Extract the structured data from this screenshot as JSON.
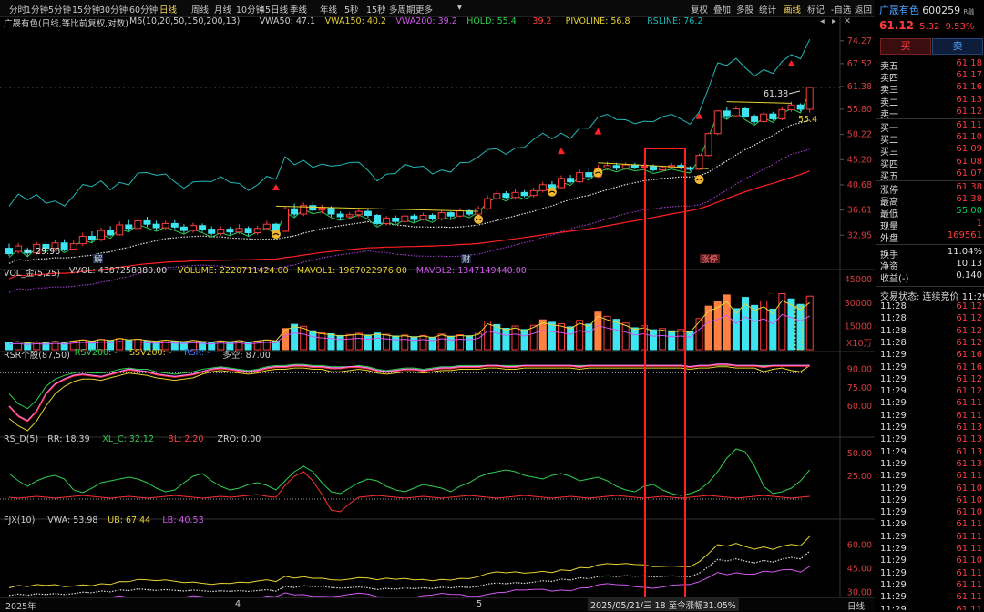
{
  "timeframes": [
    "分时",
    "1分钟",
    "5分钟",
    "15分钟",
    "30分钟",
    "60分钟",
    "日线",
    "周线",
    "月线",
    "10分钟",
    "45日线",
    "季线",
    "年线",
    "5秒",
    "15秒",
    "多周期",
    "更多"
  ],
  "active_timeframe": "日线",
  "toolbar_right": [
    "复权",
    "叠加",
    "多股",
    "统计",
    "画线",
    "标记",
    "-自选",
    "返回"
  ],
  "toolbar_active": "画线",
  "chart_title": "广晟有色(日线,等比前复权,对数)",
  "main_legend": [
    {
      "text": "M6(10,20,50,150,200,13)",
      "color": "#cfcfcf"
    },
    {
      "text": "VWA50: 47.1",
      "color": "#cfcfcf"
    },
    {
      "text": "VWA150: 40.2",
      "color": "#e8d431"
    },
    {
      "text": "VWA200: 39.2",
      "color": "#d257f0"
    },
    {
      "text": "HOLD: 55.4",
      "color": "#2fce4f"
    },
    {
      "text": ": 39.2",
      "color": "#ff4040"
    },
    {
      "text": "PIVOLINE: 56.8",
      "color": "#e8d431"
    },
    {
      "text": "RSLINE: 76.2",
      "color": "#20b8b8"
    }
  ],
  "price_axis": [
    "74.27",
    "67.52",
    "61.38",
    "55.80",
    "50.22",
    "45.20",
    "40.68",
    "36.61",
    "32.95"
  ],
  "min_label": "← 29.96",
  "high_label": "61.38",
  "hold_label": "55.4",
  "markers": {
    "jie": "解",
    "cai": "财",
    "zhangting": "涨停"
  },
  "vol_legend": [
    {
      "text": "VOL_金(5,25)",
      "color": "#cfcfcf"
    },
    {
      "text": "VVOL: 4387258880.00",
      "color": "#cfcfcf"
    },
    {
      "text": "VOLUME: 2220711424.00",
      "color": "#e8d431"
    },
    {
      "text": "MAVOL1: 1967022976.00",
      "color": "#e8d431"
    },
    {
      "text": "MAVOL2: 1347149440.00",
      "color": "#d257f0"
    }
  ],
  "vol_axis": [
    "45000",
    "30000",
    "15000"
  ],
  "vol_unit": "X10万",
  "rsr_legend": [
    {
      "text": "RSR个股(87,50)",
      "color": "#cfcfcf"
    },
    {
      "text": "RSV200: -",
      "color": "#2fce4f"
    },
    {
      "text": "SSV200: -",
      "color": "#e8d431"
    },
    {
      "text": "RSR: -",
      "color": "#3a7bff"
    },
    {
      "text": "多空: 87.00",
      "color": "#cfcfcf"
    }
  ],
  "rsr_axis": [
    "90.00",
    "75.00",
    "60.00"
  ],
  "rsd_legend": [
    {
      "text": "RS_D(5)",
      "color": "#cfcfcf"
    },
    {
      "text": "RR: 18.39",
      "color": "#cfcfcf"
    },
    {
      "text": "XL_C: 32.12",
      "color": "#2fce4f"
    },
    {
      "text": "BL: 2.20",
      "color": "#ff4040"
    },
    {
      "text": "ZRO: 0.00",
      "color": "#cfcfcf"
    }
  ],
  "rsd_axis": [
    "50.00",
    "25.00"
  ],
  "fjx_legend": [
    {
      "text": "FJX(10)",
      "color": "#cfcfcf"
    },
    {
      "text": "VWA: 53.98",
      "color": "#cfcfcf"
    },
    {
      "text": "UB: 67.44",
      "color": "#e8d431"
    },
    {
      "text": "LB: 40.53",
      "color": "#d257f0"
    }
  ],
  "fjx_axis": [
    "60.00",
    "45.00",
    "30.00"
  ],
  "date_labels": [
    "2025年",
    "4",
    "5"
  ],
  "bottom_info": "2025/05/21/三 18 至今涨幅31.05%",
  "bottom_right": "日线",
  "stock": {
    "name": "广晟有色",
    "code": "600259",
    "suffix": "R融",
    "price": "61.12",
    "change": "5.32",
    "pct": "9.53%",
    "buy": "买",
    "sell": "卖"
  },
  "asks": [
    {
      "label": "卖五",
      "price": "61.18"
    },
    {
      "label": "卖四",
      "price": "61.17"
    },
    {
      "label": "卖三",
      "price": "61.16"
    },
    {
      "label": "卖二",
      "price": "61.13"
    },
    {
      "label": "卖一",
      "price": "61.12"
    }
  ],
  "bids": [
    {
      "label": "买一",
      "price": "61.11"
    },
    {
      "label": "买二",
      "price": "61.10"
    },
    {
      "label": "买三",
      "price": "61.09"
    },
    {
      "label": "买四",
      "price": "61.08"
    },
    {
      "label": "买五",
      "price": "61.07"
    }
  ],
  "stats": [
    {
      "label": "涨停",
      "value": "61.38",
      "color": "red"
    },
    {
      "label": "最高",
      "value": "61.38",
      "color": "red"
    },
    {
      "label": "最低",
      "value": "55.00",
      "color": "green"
    },
    {
      "label": "现量",
      "value": "1",
      "color": "red"
    },
    {
      "label": "外盘",
      "value": "169561",
      "color": "red"
    }
  ],
  "stats2": [
    {
      "label": "换手",
      "value": "11.04%"
    },
    {
      "label": "净资",
      "value": "10.13"
    },
    {
      "label": "收益(-)",
      "value": "0.140"
    }
  ],
  "trade_status": "交易状态: 连续竞价 11:29",
  "ticks": [
    {
      "t": "11:28",
      "p": "61.12"
    },
    {
      "t": "11:28",
      "p": "61.12"
    },
    {
      "t": "11:28",
      "p": "61.12"
    },
    {
      "t": "11:28",
      "p": "61.12"
    },
    {
      "t": "11:29",
      "p": "61.16"
    },
    {
      "t": "11:29",
      "p": "61.16"
    },
    {
      "t": "11:29",
      "p": "61.12"
    },
    {
      "t": "11:29",
      "p": "61.12"
    },
    {
      "t": "11:29",
      "p": "61.11"
    },
    {
      "t": "11:29",
      "p": "61.11"
    },
    {
      "t": "11:29",
      "p": "61.13"
    },
    {
      "t": "11:29",
      "p": "61.13"
    },
    {
      "t": "11:29",
      "p": "61.13"
    },
    {
      "t": "11:29",
      "p": "61.13"
    },
    {
      "t": "11:29",
      "p": "61.11"
    },
    {
      "t": "11:29",
      "p": "61.10"
    },
    {
      "t": "11:29",
      "p": "61.10"
    },
    {
      "t": "11:29",
      "p": "61.10"
    },
    {
      "t": "11:29",
      "p": "61.11"
    },
    {
      "t": "11:29",
      "p": "61.11"
    },
    {
      "t": "11:29",
      "p": "61.11"
    },
    {
      "t": "11:29",
      "p": "61.10"
    },
    {
      "t": "11:29",
      "p": "61.11"
    },
    {
      "t": "11:29",
      "p": "61.11"
    },
    {
      "t": "11:29",
      "p": "61.11"
    },
    {
      "t": "11:29",
      "p": "61.11"
    },
    {
      "t": "11:29",
      "p": "61.11"
    },
    {
      "t": "11:29",
      "p": "61.12"
    }
  ],
  "candles": [
    [
      31.2,
      30.5,
      31.8,
      30.2
    ],
    [
      30.8,
      31.5,
      31.9,
      30.5
    ],
    [
      31.0,
      30.6,
      31.3,
      30.1
    ],
    [
      30.6,
      31.7,
      32.0,
      30.4
    ],
    [
      31.7,
      31.2,
      32.1,
      30.9
    ],
    [
      31.2,
      31.9,
      32.3,
      31.0
    ],
    [
      31.9,
      31.1,
      32.4,
      30.8
    ],
    [
      31.1,
      31.8,
      32.2,
      30.9
    ],
    [
      31.8,
      32.8,
      33.3,
      31.5
    ],
    [
      32.8,
      32.4,
      33.5,
      32.0
    ],
    [
      32.4,
      33.6,
      34.0,
      32.1
    ],
    [
      33.6,
      33.0,
      34.2,
      32.8
    ],
    [
      33.0,
      34.4,
      34.9,
      32.9
    ],
    [
      34.4,
      33.9,
      35.1,
      33.5
    ],
    [
      33.9,
      35.0,
      35.4,
      33.6
    ],
    [
      35.0,
      34.5,
      35.6,
      34.1
    ],
    [
      34.5,
      34.0,
      35.0,
      33.6
    ],
    [
      34.0,
      34.6,
      35.0,
      33.7
    ],
    [
      34.6,
      34.1,
      35.1,
      33.8
    ],
    [
      34.1,
      33.6,
      34.5,
      33.2
    ],
    [
      33.6,
      34.3,
      34.7,
      33.3
    ],
    [
      34.3,
      33.8,
      34.6,
      33.4
    ],
    [
      33.8,
      33.2,
      34.2,
      32.9
    ],
    [
      33.2,
      33.8,
      34.2,
      32.9
    ],
    [
      33.8,
      33.4,
      34.1,
      33.0
    ],
    [
      33.4,
      33.9,
      34.5,
      33.1
    ],
    [
      33.9,
      33.3,
      34.2,
      32.8
    ],
    [
      33.3,
      33.9,
      34.3,
      33.0
    ],
    [
      33.9,
      34.5,
      35.0,
      33.6
    ],
    [
      34.5,
      33.5,
      34.7,
      33.2
    ],
    [
      33.5,
      36.8,
      37.2,
      33.4
    ],
    [
      36.8,
      36.0,
      37.6,
      35.6
    ],
    [
      36.0,
      37.3,
      37.8,
      35.7
    ],
    [
      37.3,
      36.6,
      37.9,
      36.2
    ],
    [
      36.6,
      36.9,
      37.4,
      36.1
    ],
    [
      36.9,
      36.0,
      37.2,
      35.6
    ],
    [
      36.0,
      35.6,
      36.4,
      35.1
    ],
    [
      35.6,
      35.9,
      36.3,
      35.2
    ],
    [
      35.9,
      36.4,
      36.8,
      35.5
    ],
    [
      36.4,
      35.8,
      36.7,
      35.4
    ],
    [
      35.8,
      34.6,
      36.0,
      34.3
    ],
    [
      34.6,
      35.4,
      35.7,
      34.3
    ],
    [
      35.4,
      34.9,
      35.8,
      34.6
    ],
    [
      34.9,
      35.7,
      36.1,
      34.7
    ],
    [
      35.7,
      35.2,
      36.0,
      34.8
    ],
    [
      35.2,
      35.8,
      36.2,
      35.0
    ],
    [
      35.8,
      35.3,
      36.1,
      35.0
    ],
    [
      35.3,
      36.2,
      36.5,
      35.0
    ],
    [
      36.2,
      35.7,
      36.4,
      35.3
    ],
    [
      35.7,
      36.5,
      36.9,
      35.5
    ],
    [
      36.5,
      36.0,
      36.8,
      35.7
    ],
    [
      36.0,
      36.8,
      37.2,
      35.8
    ],
    [
      36.8,
      38.4,
      38.9,
      36.6
    ],
    [
      38.4,
      39.2,
      39.8,
      38.1
    ],
    [
      39.2,
      38.6,
      39.6,
      38.3
    ],
    [
      38.6,
      39.4,
      39.9,
      38.3
    ],
    [
      39.4,
      38.9,
      39.8,
      38.6
    ],
    [
      38.9,
      39.7,
      40.2,
      38.6
    ],
    [
      39.7,
      40.7,
      41.2,
      39.4
    ],
    [
      40.7,
      40.2,
      41.3,
      39.8
    ],
    [
      40.2,
      41.8,
      42.3,
      40.0
    ],
    [
      41.8,
      41.2,
      42.4,
      40.9
    ],
    [
      41.2,
      42.8,
      43.4,
      41.0
    ],
    [
      42.8,
      42.1,
      43.6,
      41.7
    ],
    [
      42.1,
      43.6,
      44.2,
      41.9
    ],
    [
      43.6,
      44.1,
      44.8,
      43.2
    ],
    [
      44.1,
      43.6,
      44.6,
      43.2
    ],
    [
      43.6,
      44.2,
      44.7,
      43.3
    ],
    [
      44.2,
      43.8,
      44.6,
      43.4
    ],
    [
      43.8,
      44.0,
      44.5,
      43.5
    ],
    [
      44.0,
      43.3,
      44.3,
      43.0
    ],
    [
      43.3,
      43.7,
      44.1,
      43.1
    ],
    [
      43.7,
      44.1,
      44.6,
      43.4
    ],
    [
      44.1,
      43.7,
      44.5,
      43.4
    ],
    [
      43.7,
      43.4,
      44.0,
      43.1
    ],
    [
      43.4,
      46.0,
      46.3,
      43.3
    ],
    [
      46.0,
      50.4,
      50.6,
      45.8
    ],
    [
      50.4,
      55.4,
      55.6,
      50.1
    ],
    [
      55.4,
      54.3,
      56.4,
      53.6
    ],
    [
      54.3,
      55.9,
      56.6,
      53.9
    ],
    [
      55.9,
      54.2,
      56.3,
      53.8
    ],
    [
      54.2,
      53.0,
      54.6,
      52.5
    ],
    [
      53.0,
      54.7,
      55.3,
      52.7
    ],
    [
      54.7,
      53.6,
      55.2,
      53.2
    ],
    [
      53.6,
      55.7,
      56.4,
      53.3
    ],
    [
      55.7,
      56.8,
      57.6,
      55.2
    ],
    [
      56.8,
      55.8,
      57.2,
      55.3
    ],
    [
      55.8,
      61.1,
      61.4,
      55.0
    ]
  ],
  "volumes": [
    [
      2.8,
      0
    ],
    [
      3.1,
      1
    ],
    [
      2.5,
      0
    ],
    [
      3.0,
      1
    ],
    [
      2.6,
      0
    ],
    [
      3.2,
      1
    ],
    [
      2.7,
      0
    ],
    [
      3.4,
      1
    ],
    [
      3.9,
      1
    ],
    [
      3.3,
      0
    ],
    [
      4.1,
      1
    ],
    [
      3.6,
      0
    ],
    [
      4.5,
      1
    ],
    [
      3.9,
      0
    ],
    [
      4.2,
      1
    ],
    [
      3.6,
      0
    ],
    [
      3.3,
      0
    ],
    [
      3.8,
      1
    ],
    [
      3.4,
      0
    ],
    [
      3.1,
      0
    ],
    [
      3.7,
      1
    ],
    [
      3.2,
      0
    ],
    [
      2.9,
      0
    ],
    [
      3.5,
      1
    ],
    [
      3.0,
      0
    ],
    [
      3.6,
      1
    ],
    [
      2.8,
      0
    ],
    [
      3.4,
      1
    ],
    [
      3.9,
      1
    ],
    [
      3.5,
      0
    ],
    [
      8.5,
      2
    ],
    [
      10.2,
      0
    ],
    [
      9.4,
      1
    ],
    [
      7.6,
      0
    ],
    [
      6.8,
      1
    ],
    [
      6.4,
      0
    ],
    [
      5.7,
      0
    ],
    [
      6.1,
      1
    ],
    [
      6.6,
      1
    ],
    [
      5.9,
      0
    ],
    [
      6.7,
      0
    ],
    [
      6.2,
      1
    ],
    [
      5.5,
      0
    ],
    [
      5.9,
      1
    ],
    [
      5.2,
      0
    ],
    [
      5.7,
      1
    ],
    [
      5.0,
      0
    ],
    [
      6.3,
      1
    ],
    [
      5.4,
      0
    ],
    [
      6.0,
      1
    ],
    [
      5.6,
      0
    ],
    [
      6.5,
      1
    ],
    [
      11.5,
      1
    ],
    [
      10.1,
      0
    ],
    [
      8.6,
      0
    ],
    [
      9.5,
      1
    ],
    [
      8.1,
      0
    ],
    [
      9.8,
      1
    ],
    [
      12.0,
      2
    ],
    [
      11.0,
      0
    ],
    [
      10.4,
      1
    ],
    [
      9.2,
      0
    ],
    [
      11.8,
      1
    ],
    [
      10.3,
      0
    ],
    [
      15.1,
      2
    ],
    [
      13.4,
      1
    ],
    [
      12.2,
      0
    ],
    [
      10.7,
      1
    ],
    [
      8.8,
      0
    ],
    [
      9.6,
      1
    ],
    [
      8.0,
      0
    ],
    [
      8.5,
      1
    ],
    [
      7.6,
      0
    ],
    [
      8.1,
      1
    ],
    [
      7.4,
      0
    ],
    [
      12.5,
      1
    ],
    [
      17.5,
      2
    ],
    [
      19.2,
      2
    ],
    [
      22.0,
      2
    ],
    [
      16.5,
      0
    ],
    [
      21.0,
      0
    ],
    [
      17.8,
      0
    ],
    [
      19.6,
      1
    ],
    [
      16.3,
      0
    ],
    [
      22.5,
      1
    ],
    [
      20.4,
      0
    ],
    [
      18.2,
      0
    ],
    [
      21.5,
      1
    ]
  ],
  "rsd_green": [
    28,
    20,
    14,
    20,
    24,
    26,
    22,
    10,
    7,
    12,
    18,
    20,
    22,
    24,
    22,
    18,
    12,
    8,
    10,
    18,
    25,
    28,
    20,
    14,
    10,
    12,
    16,
    18,
    15,
    10,
    20,
    30,
    36,
    30,
    18,
    8,
    6,
    12,
    18,
    22,
    20,
    14,
    10,
    8,
    12,
    16,
    14,
    12,
    8,
    14,
    18,
    24,
    28,
    30,
    32,
    30,
    26,
    24,
    22,
    26,
    28,
    25,
    20,
    22,
    24,
    20,
    14,
    10,
    8,
    14,
    16,
    10,
    6,
    4,
    6,
    10,
    18,
    30,
    45,
    55,
    52,
    36,
    14,
    6,
    8,
    12,
    20,
    32
  ],
  "rsd_red": [
    2,
    1,
    2,
    3,
    2,
    1,
    2,
    3,
    4,
    3,
    2,
    1,
    2,
    3,
    2,
    1,
    2,
    3,
    4,
    3,
    2,
    1,
    2,
    3,
    2,
    3,
    4,
    5,
    3,
    2,
    15,
    25,
    30,
    20,
    5,
    -12,
    -14,
    -5,
    2,
    3,
    4,
    3,
    2,
    1,
    2,
    3,
    2,
    1,
    2,
    3,
    4,
    3,
    2,
    1,
    2,
    3,
    4,
    3,
    2,
    1,
    2,
    3,
    2,
    1,
    2,
    3,
    4,
    3,
    2,
    1,
    2,
    3,
    2,
    1,
    2,
    3,
    4,
    3,
    2,
    1,
    2,
    3,
    4,
    3,
    2,
    1,
    2,
    3
  ],
  "rsr_line1": [
    60,
    52,
    48,
    56,
    70,
    78,
    82,
    85,
    86,
    85,
    84,
    86,
    88,
    90,
    89,
    88,
    86,
    85,
    84,
    85,
    86,
    88,
    90,
    91,
    90,
    89,
    88,
    89,
    91,
    92,
    92,
    93,
    93,
    92,
    92,
    91,
    91,
    92,
    92,
    91,
    89,
    88,
    89,
    90,
    90,
    89,
    90,
    91,
    91,
    92,
    92,
    92,
    93,
    93,
    92,
    92,
    93,
    93,
    93,
    93,
    93,
    93,
    92,
    93,
    93,
    93,
    93,
    93,
    93,
    93,
    93,
    93,
    93,
    93,
    92,
    93,
    93,
    94,
    94,
    93,
    93,
    93,
    92,
    93,
    93,
    93,
    93,
    93
  ],
  "rsr_line2": [
    70,
    62,
    58,
    65,
    76,
    82,
    85,
    87,
    88,
    87,
    87,
    88,
    90,
    91,
    90,
    90,
    88,
    87,
    86,
    87,
    88,
    90,
    91,
    92,
    91,
    90,
    89,
    90,
    92,
    93,
    93,
    94,
    94,
    93,
    93,
    92,
    92,
    92,
    93,
    92,
    90,
    89,
    90,
    91,
    91,
    90,
    91,
    92,
    92,
    93,
    93,
    93,
    93,
    93,
    93,
    93,
    93,
    93,
    93,
    93,
    93,
    93,
    93,
    93,
    93,
    93,
    93,
    93,
    93,
    93,
    93,
    93,
    93,
    93,
    92,
    93,
    93,
    93,
    93,
    93,
    93,
    93,
    93,
    93,
    93,
    93,
    93,
    93
  ],
  "rsr_line3": [
    50,
    44,
    40,
    48,
    60,
    70,
    76,
    80,
    82,
    82,
    81,
    83,
    85,
    87,
    86,
    85,
    83,
    82,
    81,
    82,
    83,
    86,
    88,
    89,
    88,
    87,
    86,
    87,
    89,
    90,
    90,
    91,
    91,
    90,
    90,
    88,
    88,
    89,
    90,
    89,
    87,
    86,
    87,
    88,
    88,
    87,
    88,
    89,
    89,
    90,
    90,
    90,
    91,
    91,
    90,
    90,
    91,
    91,
    91,
    91,
    91,
    91,
    90,
    91,
    91,
    91,
    91,
    91,
    91,
    91,
    91,
    91,
    91,
    91,
    90,
    91,
    91,
    92,
    92,
    91,
    91,
    91,
    88,
    90,
    91,
    89,
    88,
    93
  ]
}
